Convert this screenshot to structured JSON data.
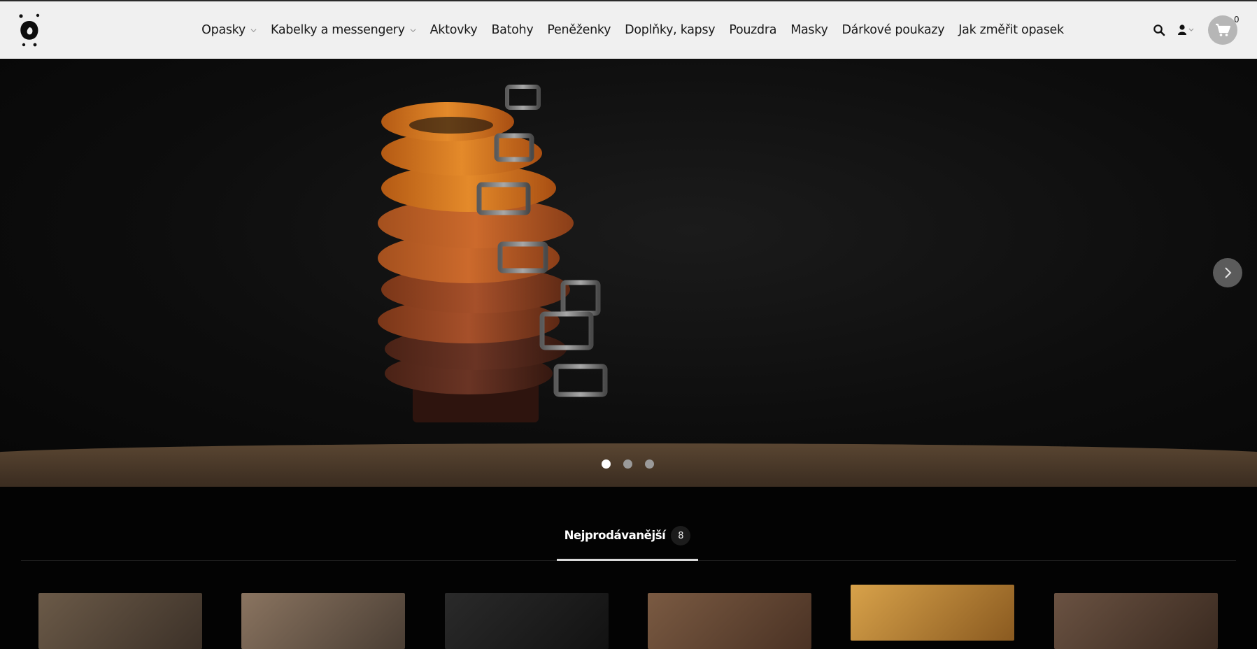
{
  "header": {
    "nav": [
      {
        "label": "Opasky",
        "has_dropdown": true
      },
      {
        "label": "Kabelky a messengery",
        "has_dropdown": true
      },
      {
        "label": "Aktovky",
        "has_dropdown": false
      },
      {
        "label": "Batohy",
        "has_dropdown": false
      },
      {
        "label": "Peněženky",
        "has_dropdown": false
      },
      {
        "label": "Doplňky, kapsy",
        "has_dropdown": false
      },
      {
        "label": "Pouzdra",
        "has_dropdown": false
      },
      {
        "label": "Masky",
        "has_dropdown": false
      },
      {
        "label": "Dárkové poukazy",
        "has_dropdown": false
      },
      {
        "label": "Jak změřit opasek",
        "has_dropdown": false
      }
    ],
    "icons": [
      "logo-icon",
      "search-icon",
      "user-icon",
      "cart-icon"
    ],
    "cart_count": "0"
  },
  "hero": {
    "slides_total": 3,
    "active_slide": 1,
    "icons": [
      "chevron-right-icon"
    ]
  },
  "bestsellers": {
    "tab_label": "Nejprodávanější",
    "count": "8"
  },
  "colors": {
    "header_bg": "#f0f0f0",
    "page_bg": "#030303",
    "cart_bg": "#b6b6b6",
    "belt_tan": "#d87a22",
    "belt_dark": "#4a2418"
  }
}
